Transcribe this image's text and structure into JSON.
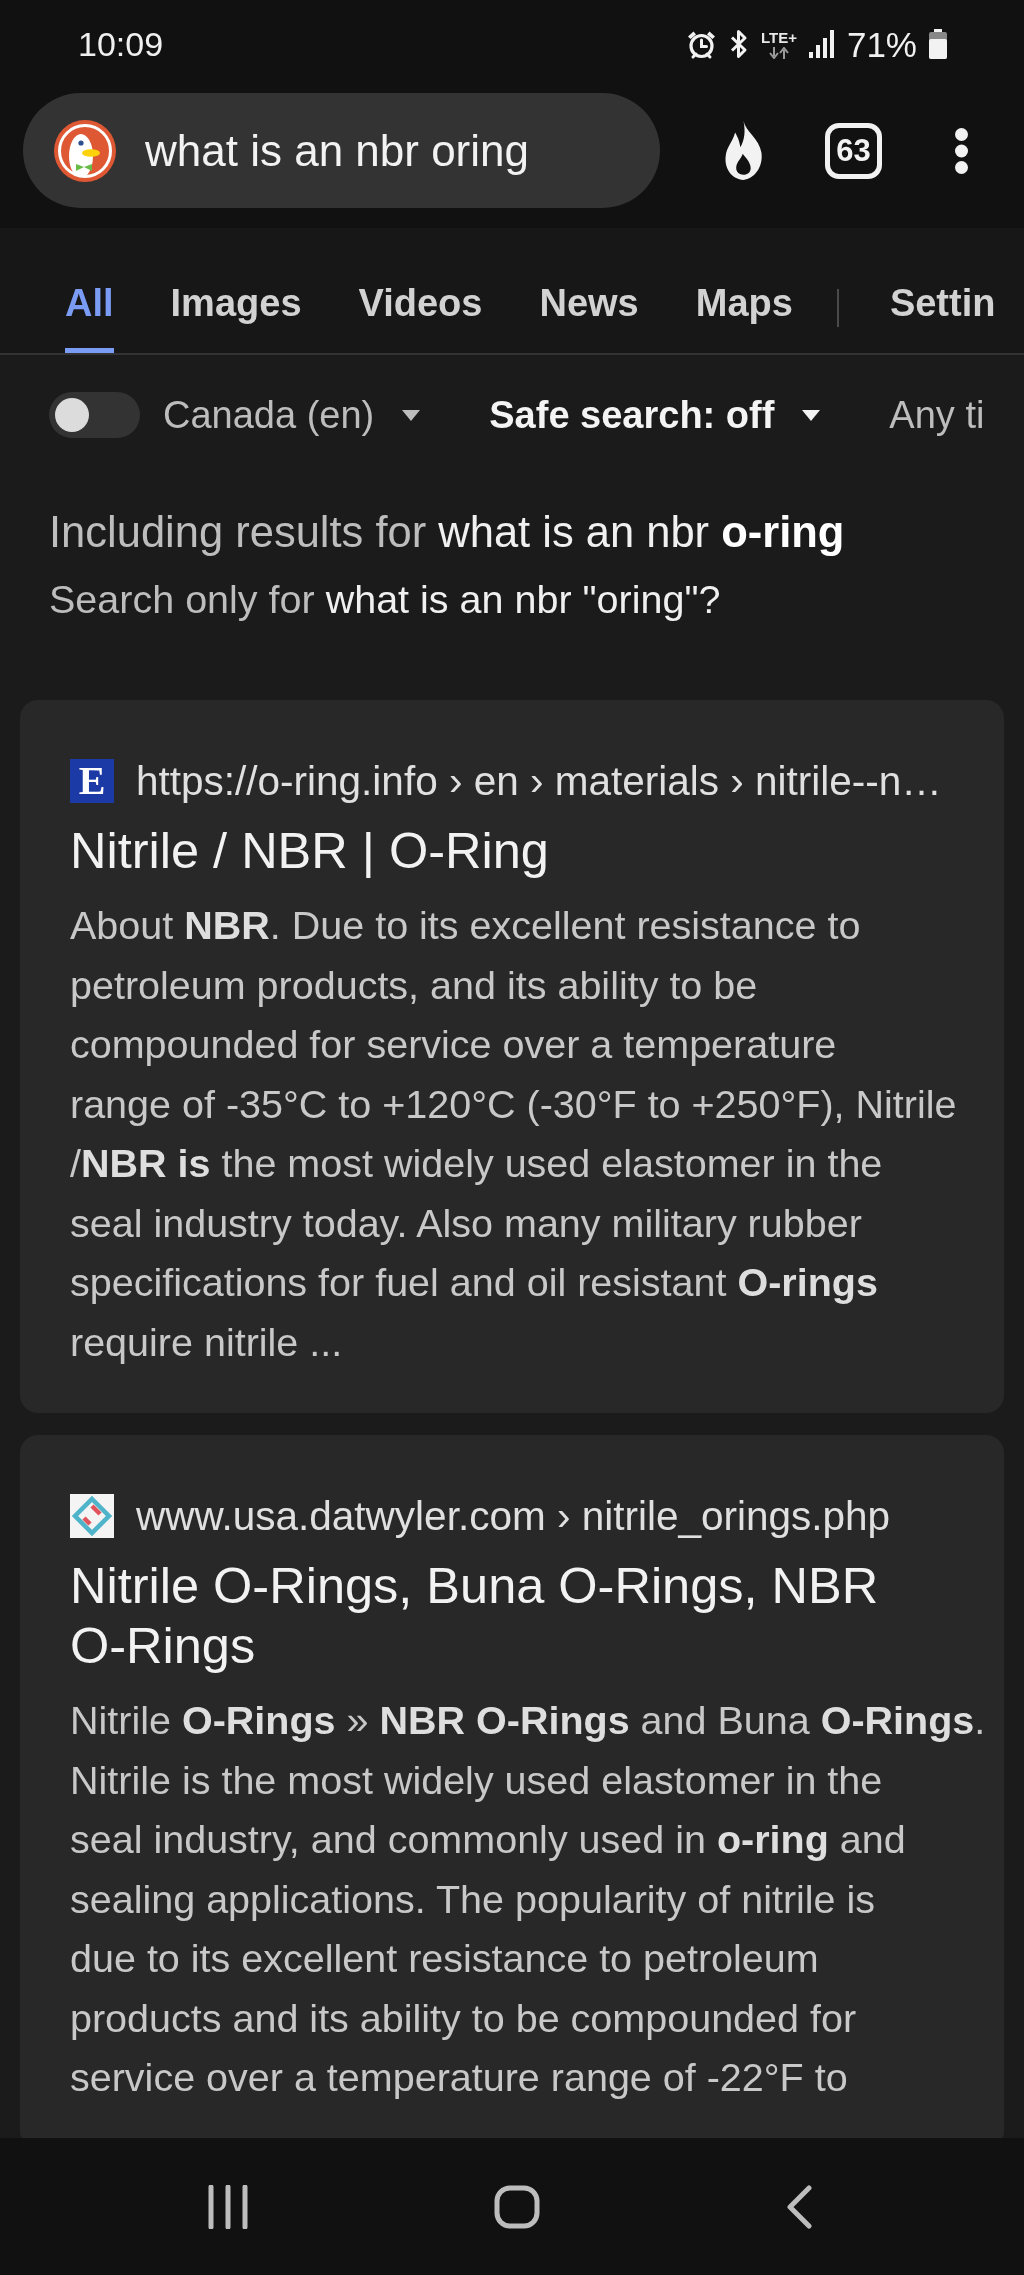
{
  "status_bar": {
    "time": "10:09",
    "network": "LTE+",
    "battery": "71%"
  },
  "search_bar": {
    "query": "what is an nbr oring",
    "tab_count": "63"
  },
  "tabs": [
    {
      "label": "All",
      "selected": true
    },
    {
      "label": "Images",
      "selected": false
    },
    {
      "label": "Videos",
      "selected": false
    },
    {
      "label": "News",
      "selected": false
    },
    {
      "label": "Maps",
      "selected": false
    }
  ],
  "settings_link": "Settin",
  "filters": {
    "switch": {
      "on": false
    },
    "dropdowns": [
      {
        "label": "Canada (en)",
        "active": false,
        "caret": true
      },
      {
        "label": "Safe search: off",
        "active": true,
        "caret": true
      },
      {
        "label": "Any ti",
        "active": false,
        "caret": false
      }
    ]
  },
  "notices": {
    "including": {
      "prefix": "Including results for",
      "query": "what is an nbr **o-ring**"
    },
    "search_only": {
      "prefix": "Search only for",
      "query": "what is an nbr \"oring\"?"
    }
  },
  "results": [
    {
      "favicon": {
        "kind": "letter",
        "text": "E"
      },
      "url": "https://o-ring.info › en › materials › nitrile--n…",
      "title": "Nitrile / NBR | O-Ring",
      "snippet": "About **NBR**. Due to its excellent resistance to\npetroleum products, and its ability to be\ncompounded for service over a temperature\nrange of -35°C to +120°C (-30°F to +250°F), Nitrile\n/**NBR is** the most widely used elastomer in the\nseal industry today. Also many military rubber\nspecifications for fuel and oil resistant **O-rings**\nrequire nitrile ..."
    },
    {
      "favicon": {
        "kind": "diamond"
      },
      "url": "www.usa.datwyler.com › nitrile_orings.php",
      "title": "Nitrile O-Rings, Buna O-Rings, NBR O-Rings",
      "snippet": "Nitrile **O-Rings** » **NBR O-Rings** and Buna **O-Rings**.\nNitrile is the most widely used elastomer in the\nseal industry, and commonly used in **o-ring** and\nsealing applications. The popularity of nitrile is\ndue to its excellent resistance to petroleum\nproducts and its ability to be compounded for\nservice over a temperature range of -22°F to"
    }
  ]
}
